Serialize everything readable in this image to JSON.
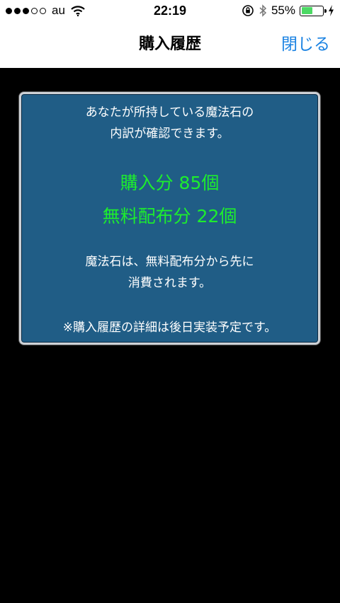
{
  "status_bar": {
    "signal_dots": {
      "filled": 3,
      "total": 5
    },
    "carrier": "au",
    "time": "22:19",
    "battery_percent": "55%",
    "battery_level": 0.55,
    "icons": [
      "wifi-icon",
      "orientation-lock-icon",
      "bluetooth-icon",
      "charging-bolt-icon"
    ]
  },
  "nav": {
    "title": "購入履歴",
    "close_label": "閉じる"
  },
  "panel": {
    "intro_line1": "あなたが所持している魔法石の",
    "intro_line2": "内訳が確認できます。",
    "purchased": "購入分 85個",
    "free": "無料配布分 22個",
    "consume_line1": "魔法石は、無料配布分から先に",
    "consume_line2": "消費されます。",
    "note": "※購入履歴の詳細は後日実装予定です。"
  },
  "colors": {
    "accent": "#1a82e2",
    "panel_bg": "#205d86",
    "highlight": "#1ded2e",
    "battery": "#4cd964"
  }
}
